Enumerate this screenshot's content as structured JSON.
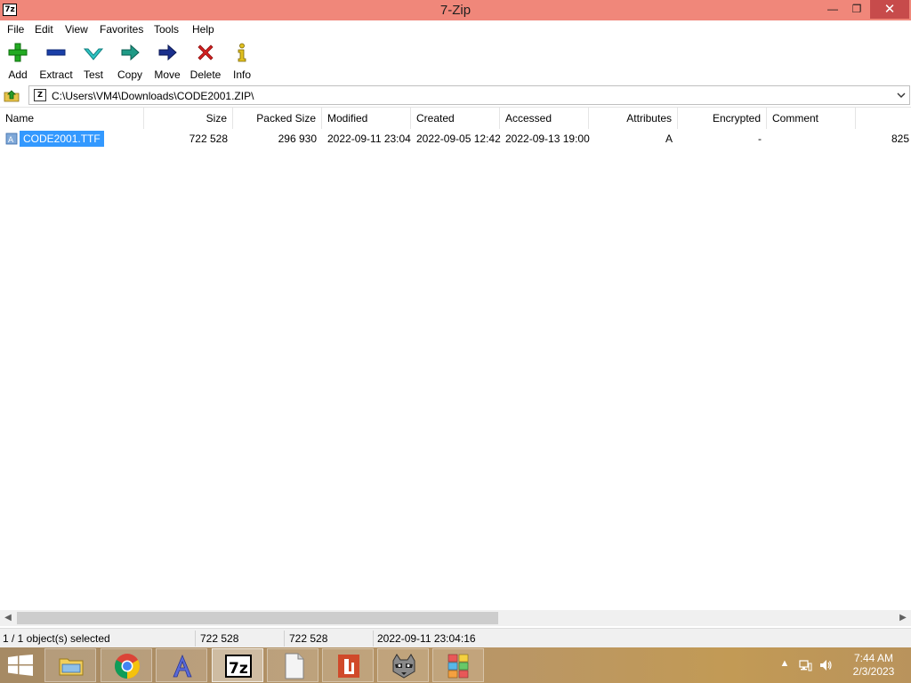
{
  "window": {
    "app_icon_text": "7z",
    "title": "7-Zip",
    "minimize_glyph": "—",
    "maximize_glyph": "❐",
    "close_glyph": "✕"
  },
  "menu": {
    "items": [
      "File",
      "Edit",
      "View",
      "Favorites",
      "Tools",
      "Help"
    ]
  },
  "toolbar": {
    "buttons": [
      {
        "label": "Add",
        "icon": "add-plus-icon",
        "color": "#22aa22"
      },
      {
        "label": "Extract",
        "icon": "extract-minus-icon",
        "color": "#1a3fa8"
      },
      {
        "label": "Test",
        "icon": "test-check-icon",
        "color": "#22b8b8"
      },
      {
        "label": "Copy",
        "icon": "copy-arrow-icon",
        "color": "#1f9a86"
      },
      {
        "label": "Move",
        "icon": "move-arrow-icon",
        "color": "#1a2f8c"
      },
      {
        "label": "Delete",
        "icon": "delete-x-icon",
        "color": "#d42020"
      },
      {
        "label": "Info",
        "icon": "info-icon",
        "color": "#e0c020"
      }
    ]
  },
  "address": {
    "path": "C:\\Users\\VM4\\Downloads\\CODE2001.ZIP\\",
    "icon_text": "Z"
  },
  "list": {
    "columns": [
      "Name",
      "Size",
      "Packed Size",
      "Modified",
      "Created",
      "Accessed",
      "Attributes",
      "Encrypted",
      "Comment"
    ],
    "rows": [
      {
        "name": "CODE2001.TTF",
        "size": "722 528",
        "packed_size": "296 930",
        "modified": "2022-09-11 23:04",
        "created": "2022-09-05 12:42",
        "accessed": "2022-09-13 19:00",
        "attributes": "A",
        "encrypted": "-",
        "comment": "",
        "overflow": "825",
        "selected": true
      }
    ]
  },
  "status": {
    "selection": "1 / 1 object(s) selected",
    "size": "722 528",
    "packed": "722 528",
    "modified": "2022-09-11 23:04:16"
  },
  "taskbar": {
    "apps": [
      {
        "name": "file-explorer",
        "icon": "folder-icon",
        "active": false
      },
      {
        "name": "chrome",
        "icon": "chrome-icon",
        "active": false
      },
      {
        "name": "font-app",
        "icon": "font-a-icon",
        "active": false
      },
      {
        "name": "7zip",
        "icon": "7zip-icon",
        "active": true
      },
      {
        "name": "document",
        "icon": "document-icon",
        "active": false
      },
      {
        "name": "office",
        "icon": "office-icon",
        "active": false
      },
      {
        "name": "raccoon-app",
        "icon": "raccoon-icon",
        "active": false
      },
      {
        "name": "charmap",
        "icon": "charmap-icon",
        "active": false
      }
    ],
    "tray_up_glyph": "▲",
    "time": "7:44 AM",
    "date": "2/3/2023"
  },
  "colors": {
    "titlebar": "#f0877a",
    "selection": "#3399ff",
    "close_button": "#c74b4b"
  }
}
